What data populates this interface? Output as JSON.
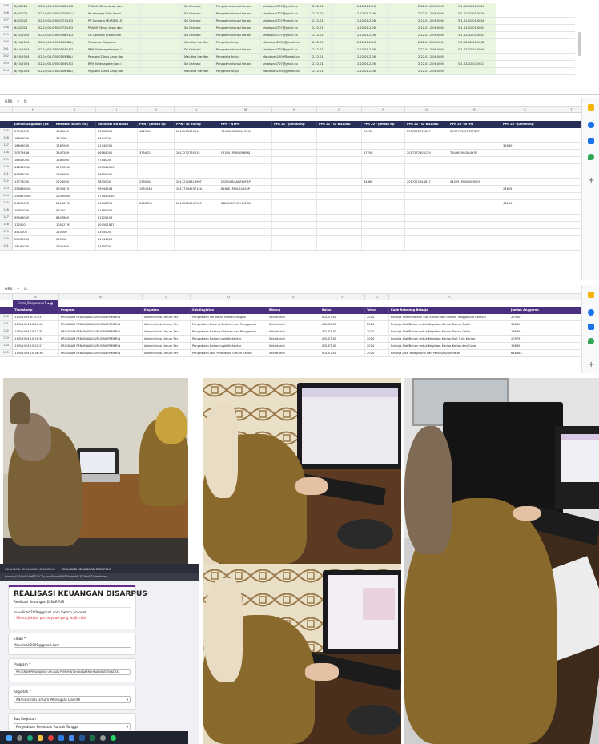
{
  "sheet1": {
    "rows": [
      {
        "num": "195",
        "cells": [
          "8/3/2024",
          "02.14/04.0/000068/LS/2",
          "PRAXIN Dinas Arsip dan",
          "",
          "Sri Cahyani",
          "Pengadministrasi Keuan",
          "srirahyani707@gmail.co",
          "2.22.01",
          "",
          "2.22.01.2.06",
          "",
          "2.22.01.2.06.0003",
          "5.1.02.01.01.0026"
        ]
      },
      {
        "num": "196",
        "cells": [
          "8/3/2024",
          "02.14/04.0/000070/ASL/",
          "Ita Sergaya Toko Aksut",
          "",
          "Sri Cahyani",
          "Pengadministrasi Keuan",
          "srirahyani707@gmail.co",
          "2.22.01",
          "",
          "2.22.01.2.06",
          "",
          "2.22.01.2.06.0004",
          "5.1.02.01.01.0026"
        ]
      },
      {
        "num": "197",
        "cells": [
          "8/3/2024",
          "02.14/04.0/000071/LS/2",
          "PT Dorbarja MURDIN LE",
          "",
          "Sri Cahyani",
          "Pengadministrasi Keuan",
          "srirahyani707@gmail.co",
          "2.22.01",
          "",
          "2.22.01.2.06",
          "",
          "2.22.01.2.06.0004",
          "5.1.02.01.01.0026"
        ]
      },
      {
        "num": "198",
        "cells": [
          "8/3/2024",
          "02.14/04.0/000072/LS/2",
          "PRAXIN Dinas Arsip dan",
          "",
          "Sri Cahyani",
          "Pengadministrasi Keuan",
          "srirahyani707@gmail.co",
          "2.22.01",
          "",
          "2.22.01.2.06",
          "",
          "2.22.01.2.06.0004",
          "5.1.02.01.01.0001"
        ]
      },
      {
        "num": "199",
        "cells": [
          "8/22/2024",
          "02.14/04.0/000098/LS/2",
          "CV Azimuth Production",
          "",
          "Sri Cahyani",
          "Pengadministrasi Keuan",
          "srirahyani707@gmail.co",
          "2.22.01",
          "",
          "2.22.01.2.06",
          "",
          "2.22.01.2.06.0004",
          "5.1.02.02.01.0047"
        ]
      },
      {
        "num": "200",
        "cells": [
          "8/15/2024",
          "02.14/04.0/000100/BLL/",
          "Pascudan Bisqswes",
          "",
          "Maudina Hanifah",
          "Pengelola Arsip",
          "Maudinah2000@gmail.co",
          "2.22.01",
          "",
          "2.22.01.2.06",
          "",
          "2.22.01.2.06.0004",
          "5.1.02.02.01.0062"
        ]
      },
      {
        "num": "201",
        "cells": [
          "8/14/2024",
          "02.14/04.0/000104/LS/2",
          "BPJS Ketenagakerjaan I",
          "",
          "Sri Cahyani",
          "Pengadministrasi Keuan",
          "srirahyani707@gmail.co",
          "2.22.01",
          "",
          "2.22.01.2.06",
          "",
          "2.22.01.2.06.0004",
          "5.1.02.02.03.0009"
        ]
      },
      {
        "num": "202",
        "cells": [
          "8/20/2024",
          "02.14/04.0/000105/BLL/",
          "Pegawai Dinas Arsip dar",
          "",
          "Maudina Hanifah",
          "Pengelola Arsip",
          "Maudinah2000@gmail.co",
          "2.22.01",
          "",
          "2.22.01.2.06",
          "",
          "2.22.01.2.06.0009",
          ""
        ]
      },
      {
        "num": "203",
        "cells": [
          "8/10/2024",
          "02.14/04.0/000104/LS/2",
          "BPJS Ketenagakerjaan I",
          "",
          "Sri Cahyani",
          "Pengadministrasi Keuan",
          "srirahyani707@gmail.co",
          "2.22.01",
          "",
          "2.22.01.2.06",
          "",
          "2.22.01.2.06.0004",
          "5.1.02.02.03.0027"
        ]
      },
      {
        "num": "204",
        "cells": [
          "8/29/2024",
          "02.14/04.0/000106/BLL/",
          "Pegawai Dinas Arsip dar",
          "",
          "Maudina Hanifah",
          "Pengelola Arsip",
          "Maudinah2000@gmail.co",
          "2.22.01",
          "",
          "2.22.01.2.06",
          "",
          "2.22.01.2.06.0009",
          ""
        ]
      }
    ]
  },
  "sheet2": {
    "cellref": "GR0",
    "fx": "fx",
    "columns": [
      "H",
      "I",
      "J",
      "K",
      "L",
      "M",
      "N",
      "O",
      "P",
      "Q",
      "R",
      "S",
      "T"
    ],
    "headers": [
      "Jumlah Anggaran (Pa",
      "Realisasi Bulan ini (",
      "Realisasi s/d Bulan",
      "PPN - Jumlah Rp",
      "PPN - ID Billing",
      "PPN - NTPN",
      "PPh 21 - Jumlah Rp",
      "PPh 21 - ID BILLING",
      "PPh 22 - Jumlah Rp",
      "PPh 22 - ID BILLING",
      "PPh 23 - NTPN",
      "PPh 23 - Jumlah Rp"
    ],
    "rows": [
      {
        "num": "135",
        "cells": [
          "57950000",
          "4964000",
          "22560000",
          "462910",
          "2017273470111",
          "74428358D8N4C7YM",
          "",
          "",
          "74760",
          "2017272705007",
          "67C77956117BF66T",
          ""
        ]
      },
      {
        "num": "136",
        "cells": [
          "18649000",
          "342000",
          "9561000",
          "",
          "",
          "",
          "",
          "",
          "",
          "",
          "",
          ""
        ]
      },
      {
        "num": "137",
        "cells": [
          "18649000",
          "1767000",
          "11740000",
          "",
          "",
          "",
          "",
          "",
          "",
          "",
          "",
          "31630"
        ]
      },
      {
        "num": "138",
        "cells": [
          "20579446",
          "3847289",
          "16164000",
          "375402",
          "2017272765015",
          "F536X1PL0MBFNRKJ",
          "",
          "",
          "87700",
          "2017272803129",
          "T3498590GEL6Y57",
          ""
        ]
      },
      {
        "num": "139",
        "cells": [
          "18635000",
          "1585000",
          "7714000",
          "",
          "",
          "",
          "",
          "",
          "",
          "",
          "",
          ""
        ]
      },
      {
        "num": "140",
        "cells": [
          "648483000",
          "69730000",
          "306564000",
          "",
          "",
          "",
          "",
          "",
          "",
          "",
          "",
          ""
        ]
      },
      {
        "num": "141",
        "cells": [
          "94383000",
          "2496000",
          "39559000",
          "",
          "",
          "",
          "",
          "",
          "",
          "",
          "",
          ""
        ]
      },
      {
        "num": "142",
        "cells": [
          "13778000",
          "2224000",
          "7835000",
          "235006",
          "2017272631890T",
          "D025I4BUAKZ4VF6P",
          "",
          "",
          "34860",
          "2017272644817",
          "445291PL0MBGRC0H",
          ""
        ]
      },
      {
        "num": "143",
        "cells": [
          "255836000",
          "5930619",
          "76944543",
          "1951944",
          "2017734493715A",
          "8268E1PL0L64AS4P",
          "",
          "",
          "",
          "",
          "",
          "24625"
        ]
      },
      {
        "num": "144",
        "cells": [
          "254933000",
          "22060000",
          "171440000",
          "",
          "",
          "",
          "",
          "",
          "",
          "",
          "",
          ""
        ]
      },
      {
        "num": "145",
        "cells": [
          "29695000",
          "24008750",
          "24008750",
          "2403750",
          "2017208494713T",
          "DBA1G1PL0VHC6WN",
          "",
          "",
          "",
          "",
          "",
          "44200"
        ]
      },
      {
        "num": "146",
        "cells": [
          "20800000",
          "55200",
          "11169000",
          "",
          "",
          "",
          "",
          "",
          "",
          "",
          "",
          ""
        ]
      },
      {
        "num": "147",
        "cells": [
          "99948000",
          "6407800",
          "61125196",
          "",
          "",
          "",
          "",
          "",
          "",
          "",
          "",
          ""
        ]
      },
      {
        "num": "148",
        "cells": [
          "132000",
          "10012793",
          "104501847",
          "",
          "",
          "",
          "",
          "",
          "",
          "",
          "",
          ""
        ]
      },
      {
        "num": "149",
        "cells": [
          "3510000",
          "210000",
          "1305000",
          "",
          "",
          "",
          "",
          "",
          "",
          "",
          "",
          ""
        ]
      },
      {
        "num": "150",
        "cells": [
          "20930000",
          "520000",
          "11941600",
          "",
          "",
          "",
          "",
          "",
          "",
          "",
          "",
          ""
        ]
      },
      {
        "num": "151",
        "cells": [
          "18190000",
          "2302400",
          "7455000",
          "",
          "",
          "",
          "",
          "",
          "",
          "",
          "",
          ""
        ]
      }
    ]
  },
  "sheet3": {
    "cellref": "GR0",
    "fx": "fx",
    "columns": [
      "A",
      "B",
      "C",
      "D",
      "E",
      "F",
      "G",
      "H",
      "I"
    ],
    "tab_label": "Form_Responses1",
    "headers": [
      "Timestamp",
      "Program",
      "Kegiatan",
      "Sub Kegiatan",
      "Bidang",
      "Bulan",
      "Tahun",
      "Kode Rekening Belanja",
      "Jumlah Anggaran"
    ],
    "rows": [
      {
        "num": "130",
        "cells": [
          "11/5/2024 8:35:13",
          "PROGRAM PENUNJANG URUSAN PEMERIN",
          "Administrasi Umum Per",
          "Penyediaan Peralatan Rumah Tangga",
          "Sekretariat",
          "AGUSTUS",
          "2024",
          "Belanja Pemeliharaan Alat Kantor dan Rumah Tangga-Alat Kantor-l",
          "27950"
        ]
      },
      {
        "num": "131",
        "cells": [
          "11/5/2024 16:09:06",
          "PROGRAM PENUNJANG URUSAN PEMERIN",
          "Administrasi Umum Per",
          "Penyediaan Barang Cetakan dan Pengganda",
          "Sekretariat",
          "AGUSTUS",
          "2024",
          "Belanja Alat/Bahan untuk Kegiatan Kantor-Bahan Cetak",
          "18649"
        ]
      },
      {
        "num": "132",
        "cells": [
          "11/5/2024 10:17:35",
          "PROGRAM PENUNJANG URUSAN PEMERIN",
          "Administrasi Umum Per",
          "Penyediaan Barang Cetakan dan Pengganda",
          "Sekretariat",
          "AGUSTUS",
          "2024",
          "Belanja Alat/Bahan untuk Kegiatan Kantor-Bahan Cetak",
          "18649"
        ]
      },
      {
        "num": "133",
        "cells": [
          "11/5/2024 10:18:34",
          "PROGRAM PENUNJANG URUSAN PEMERIN",
          "Administrasi Umum Per",
          "Penyediaan Bahan Logistik Kantor",
          "Sekretariat",
          "AGUSTUS",
          "2024",
          "Belanja Alat/Bahan untuk Kegiatan Kantor-Alat Tulis Kantor",
          "20579"
        ]
      },
      {
        "num": "134",
        "cells": [
          "11/5/2024 10:20:27",
          "PROGRAM PENUNJANG URUSAN PEMERIN",
          "Administrasi Umum Per",
          "Penyediaan Bahan Logistik Kantor",
          "Sekretariat",
          "AGUSTUS",
          "2024",
          "Belanja Alat/Bahan untuk Kegiatan Kantor-Kertas dan Cover",
          "18635"
        ]
      },
      {
        "num": "135",
        "cells": [
          "11/5/2024 10:36:30",
          "PROGRAM PENUNJANG URUSAN PEMERIN",
          "Administrasi Umum Per",
          "Penyediaan Jasa Pelayanan Umum Kantor",
          "Sekretariat",
          "AGUSTUS",
          "2024",
          "Belanja Jasa Tenaga Ahli dan Penunjuk/Operator",
          "648483"
        ]
      }
    ]
  },
  "form": {
    "tab1": "REALISASI KEUANGAN DISARPUS",
    "tab2": "REALISASI KEUANGAN DISARPUS",
    "url": "forms/d/1FAIpQLSeP321CDyAnwPmoHMNE2dqpeNk7jDXaiNT/viewform",
    "title": "REALISASI KEUANGAN DISARPUS",
    "subtitle": "Realisasi Keuangan DISARPUS",
    "account": "maudinah2000@gmail.com Switch account",
    "account_note": "* Menunjukkan pertanyaan yang wajib diisi",
    "q_email": "Email *",
    "a_email": "Maudinah2000@gmail.com",
    "q_program": "Program *",
    "a_program": "PROGRAM PENUNJANG URUSAN PEMERINTAHAN DAERAH KABUPATEN/KOTA",
    "q_kegiatan": "Kegiatan *",
    "a_kegiatan": "Administrasi Umum Perangkat Daerah",
    "q_sub": "Sub Kegiatan *",
    "a_sub": "Penyediaan Peralatan Rumah Tangga"
  },
  "colors": {
    "header_navy": "#262f57",
    "header_purple": "#4a2f7e",
    "row_highlight": "#e9f5df",
    "uniform_khaki": "#8a6a2c",
    "hijab_cream": "#e8dcc4"
  }
}
